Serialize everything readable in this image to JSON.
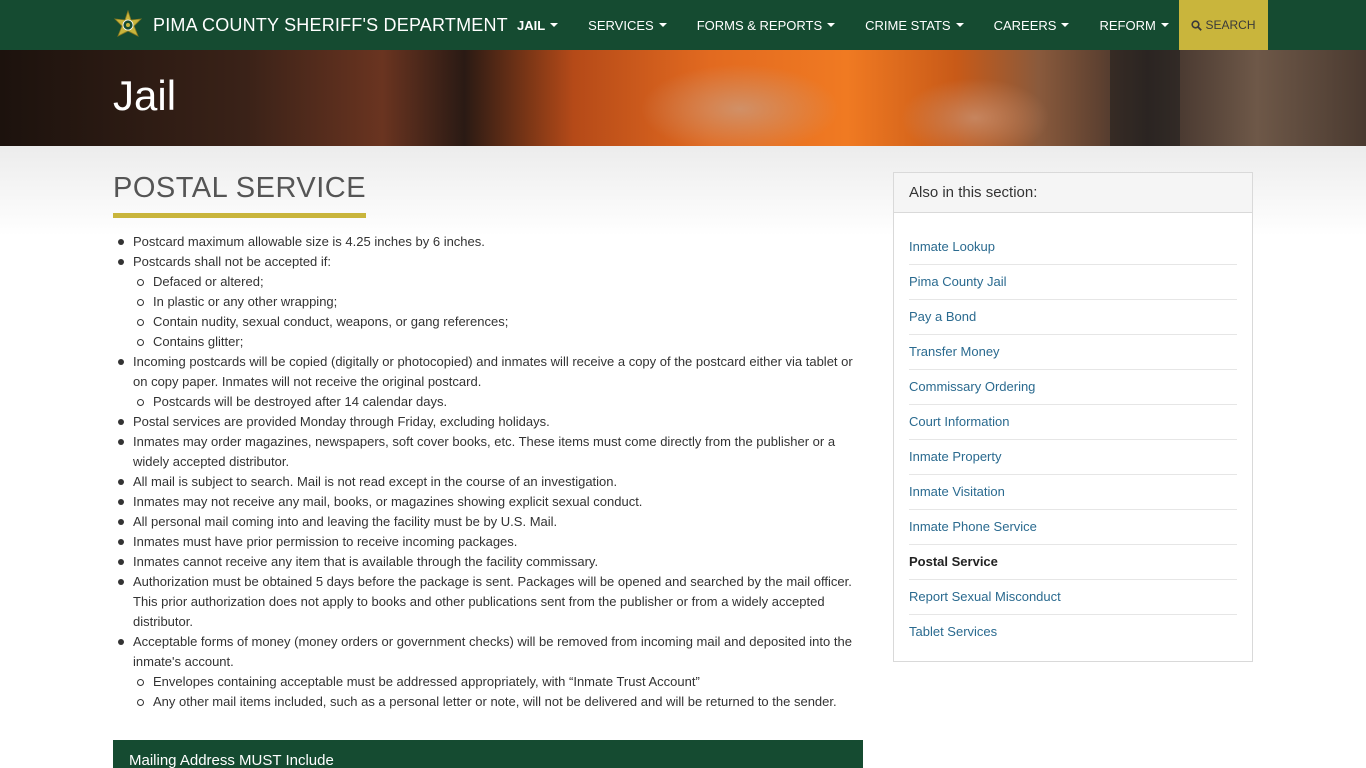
{
  "header": {
    "brand": "PIMA COUNTY SHERIFF'S DEPARTMENT",
    "nav": [
      {
        "label": "JAIL",
        "active": true
      },
      {
        "label": "SERVICES",
        "active": false
      },
      {
        "label": "FORMS & REPORTS",
        "active": false
      },
      {
        "label": "CRIME STATS",
        "active": false
      },
      {
        "label": "CAREERS",
        "active": false
      },
      {
        "label": "REFORM",
        "active": false
      }
    ],
    "search_label": "SEARCH"
  },
  "hero": {
    "title": "Jail"
  },
  "main": {
    "title": "POSTAL SERVICE",
    "items": [
      {
        "text": "Postcard maximum allowable size is 4.25 inches by 6 inches."
      },
      {
        "text": "Postcards shall not be accepted if:",
        "sub": [
          "Defaced or altered;",
          "In plastic or any other wrapping;",
          "Contain nudity, sexual conduct, weapons, or gang references;",
          "Contains glitter;"
        ]
      },
      {
        "text": "Incoming postcards will be copied (digitally or photocopied) and inmates will receive a copy of the postcard either via tablet or on copy paper.  Inmates will not receive the original postcard.",
        "sub": [
          "Postcards will be destroyed after 14 calendar days."
        ]
      },
      {
        "text": "Postal services are provided Monday through Friday, excluding holidays."
      },
      {
        "text": "Inmates may order magazines, newspapers, soft cover books, etc. These items must come directly from the publisher or a widely accepted distributor."
      },
      {
        "text": "All mail is subject to search. Mail is not read except in the course of an investigation."
      },
      {
        "text": "Inmates may not receive any mail, books, or magazines showing explicit sexual conduct."
      },
      {
        "text": "All personal mail coming into and leaving the facility must be by U.S. Mail."
      },
      {
        "text": "Inmates must have prior permission to receive incoming packages."
      },
      {
        "text": "Inmates cannot receive any item that is available through the facility commissary."
      },
      {
        "text": "Authorization must be obtained 5 days before the package is sent. Packages will be opened and searched by the mail officer. This prior authorization does not apply to books and other publications sent from the publisher or from a widely accepted distributor."
      },
      {
        "text": "Acceptable forms of money (money orders or government checks) will be removed from incoming mail and deposited into the inmate's account.",
        "sub": [
          "Envelopes containing acceptable must be addressed appropriately, with “Inmate Trust Account”",
          "Any other mail items included, such as a personal letter or note, will not be delivered and will be returned to the sender."
        ]
      }
    ],
    "mailing_heading": "Mailing Address MUST Include"
  },
  "sidebar": {
    "heading": "Also in this section:",
    "links": [
      {
        "label": "Inmate Lookup",
        "current": false
      },
      {
        "label": "Pima County Jail",
        "current": false
      },
      {
        "label": "Pay a Bond",
        "current": false
      },
      {
        "label": "Transfer Money",
        "current": false
      },
      {
        "label": "Commissary Ordering",
        "current": false
      },
      {
        "label": "Court Information",
        "current": false
      },
      {
        "label": "Inmate Property",
        "current": false
      },
      {
        "label": "Inmate Visitation",
        "current": false
      },
      {
        "label": "Inmate Phone Service",
        "current": false
      },
      {
        "label": "Postal Service",
        "current": true
      },
      {
        "label": "Report Sexual Misconduct",
        "current": false
      },
      {
        "label": "Tablet Services",
        "current": false
      }
    ]
  },
  "colors": {
    "nav_green": "#154b31",
    "accent_gold": "#c9b53c",
    "link_blue": "#2a6a8f"
  }
}
